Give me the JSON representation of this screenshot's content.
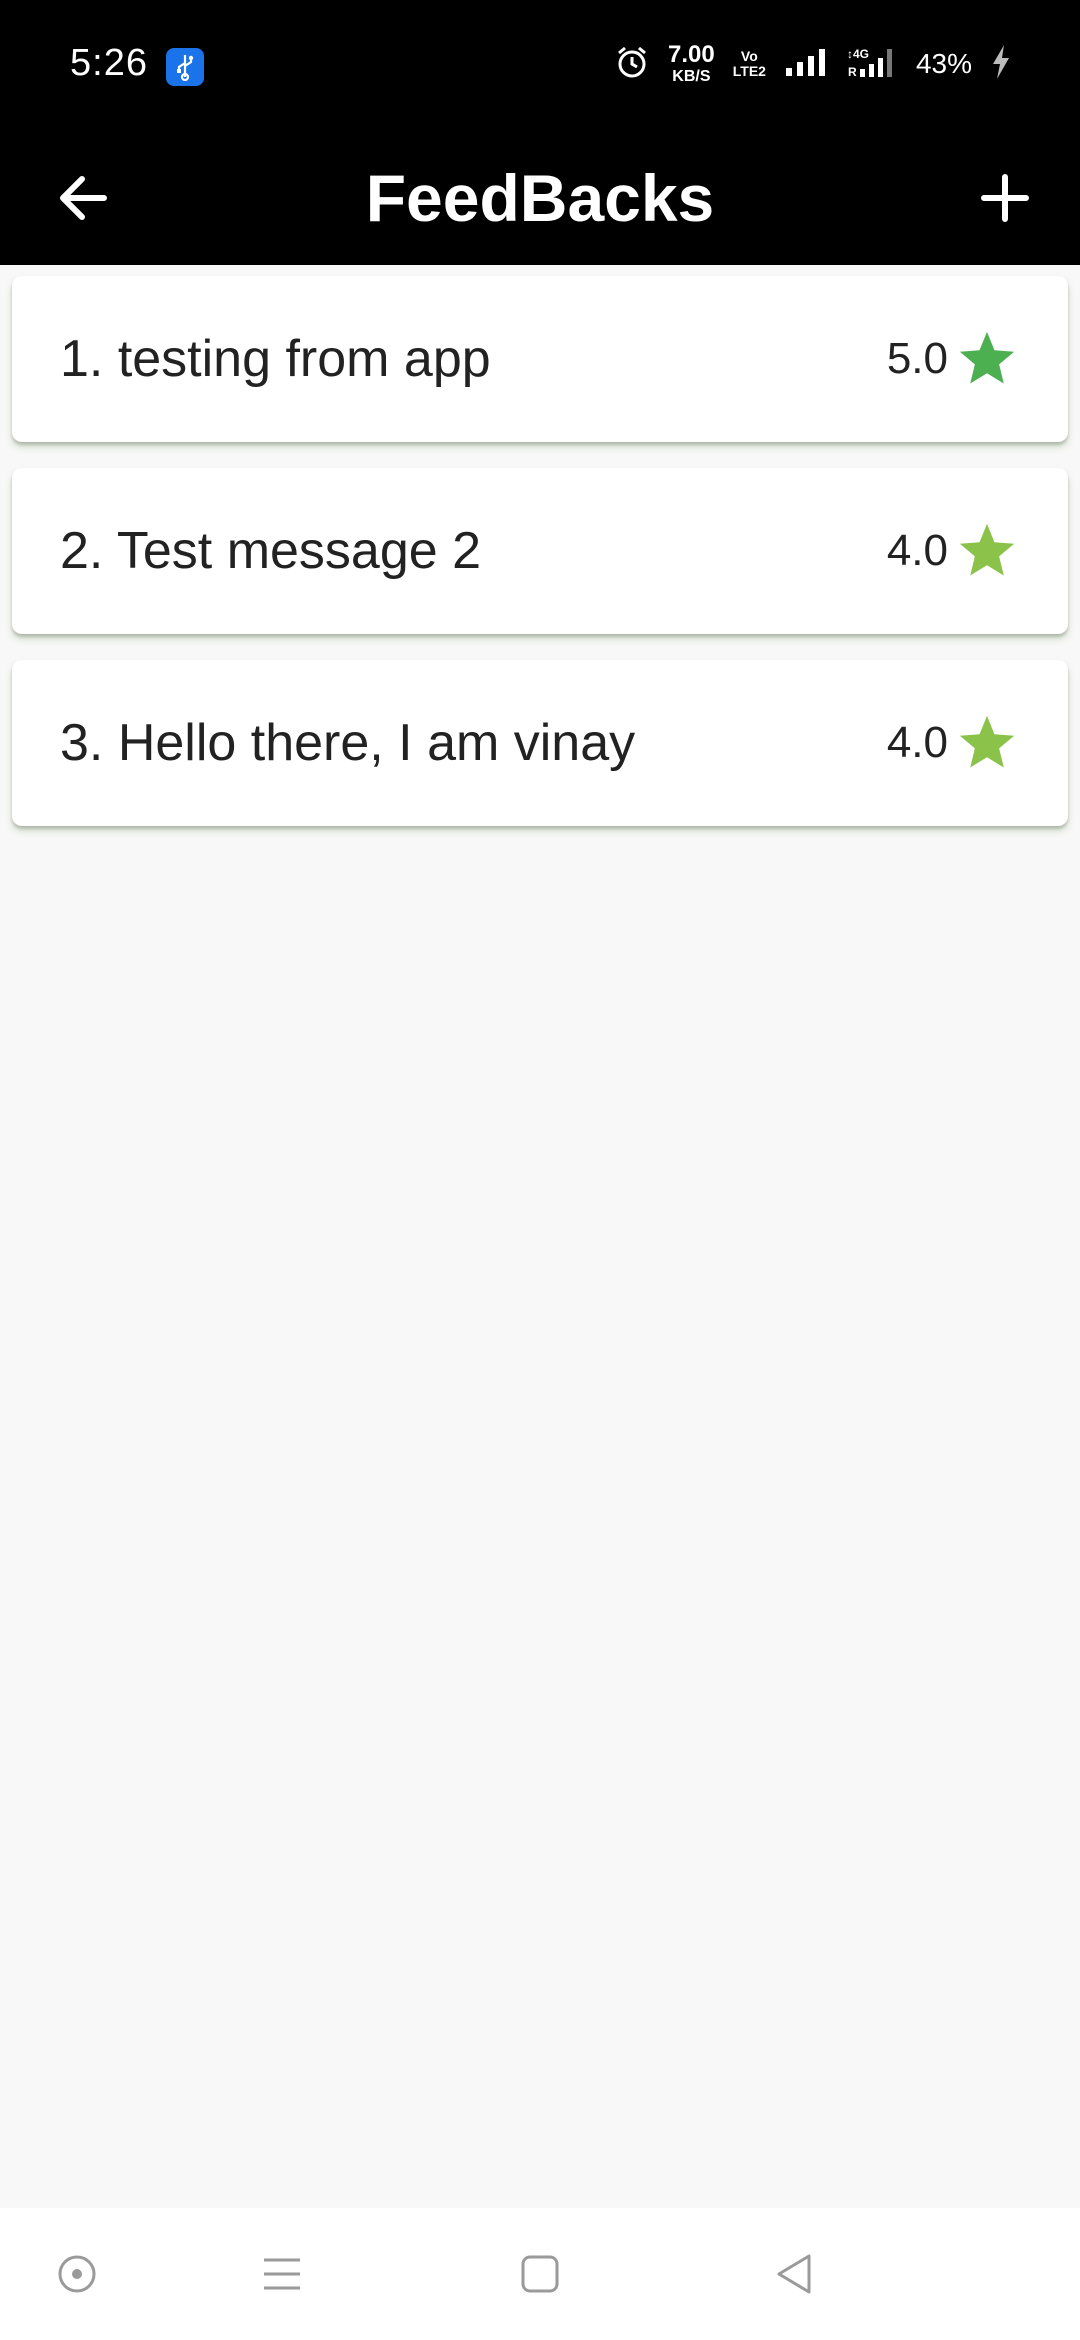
{
  "status_bar": {
    "time": "5:26",
    "net_speed_value": "7.00",
    "net_speed_unit": "KB/S",
    "volte_top": "Vo",
    "volte_bottom": "LTE2",
    "battery": "43%",
    "icons": [
      "usb-icon",
      "alarm-icon",
      "signal-icon",
      "signal-4g-icon",
      "charging-icon"
    ]
  },
  "app_bar": {
    "title": "FeedBacks",
    "back_icon": "arrow-left-icon",
    "add_icon": "plus-icon"
  },
  "feedbacks": [
    {
      "text": "1. testing from app",
      "rating": "5.0",
      "star_color": "#4caf50"
    },
    {
      "text": "2. Test message 2",
      "rating": "4.0",
      "star_color": "#8bc34a"
    },
    {
      "text": "3. Hello there, I am vinay",
      "rating": "4.0",
      "star_color": "#8bc34a"
    }
  ],
  "nav_bar": {
    "icons": [
      "assistant-icon",
      "menu-icon",
      "home-icon",
      "back-icon"
    ]
  },
  "colors": {
    "app_bar": "#000000",
    "background": "#f8f8f8",
    "usb_badge": "#1a73e8"
  }
}
